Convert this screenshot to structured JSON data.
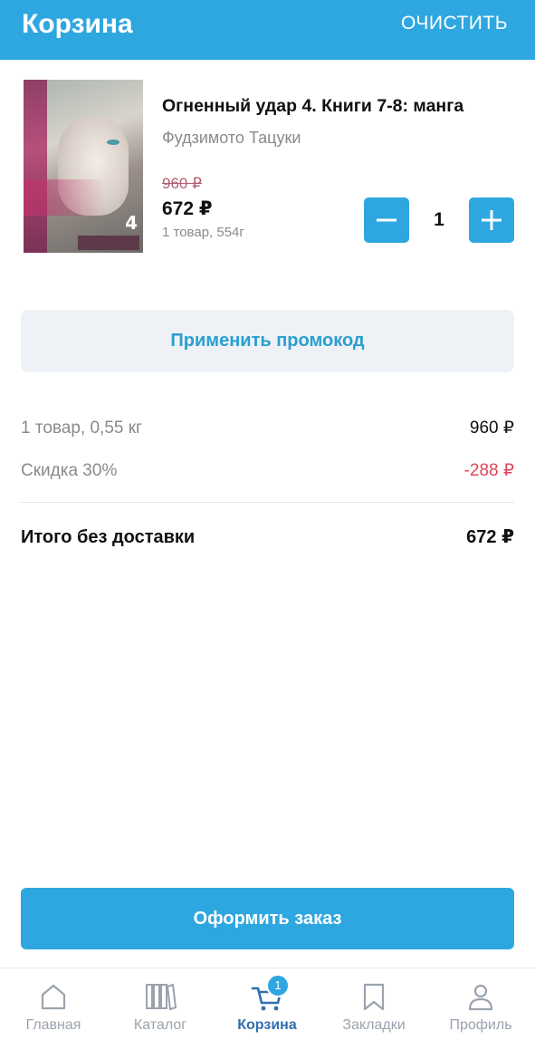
{
  "header": {
    "title": "Корзина",
    "clear_label": "ОЧИСТИТЬ"
  },
  "product": {
    "title": "Огненный удар 4. Книги 7-8: манга",
    "author": "Фудзимото Тацуки",
    "old_price": "960 ₽",
    "price": "672 ₽",
    "meta": "1 товар, 554г",
    "quantity": "1",
    "cover_volume": "4"
  },
  "promo": {
    "label": "Применить промокод"
  },
  "summary": {
    "items_label": "1 товар, 0,55 кг",
    "items_value": "960 ₽",
    "discount_label": "Скидка 30%",
    "discount_value": "-288 ₽",
    "total_label": "Итого без доставки",
    "total_value": "672 ₽"
  },
  "checkout": {
    "label": "Оформить заказ"
  },
  "tabbar": {
    "home": "Главная",
    "catalog": "Каталог",
    "cart": "Корзина",
    "cart_badge": "1",
    "bookmarks": "Закладки",
    "profile": "Профиль"
  },
  "colors": {
    "accent": "#2ea7e0",
    "active_tab": "#2f6fb0",
    "discount": "#e0465a",
    "muted": "#8a8a8a"
  }
}
